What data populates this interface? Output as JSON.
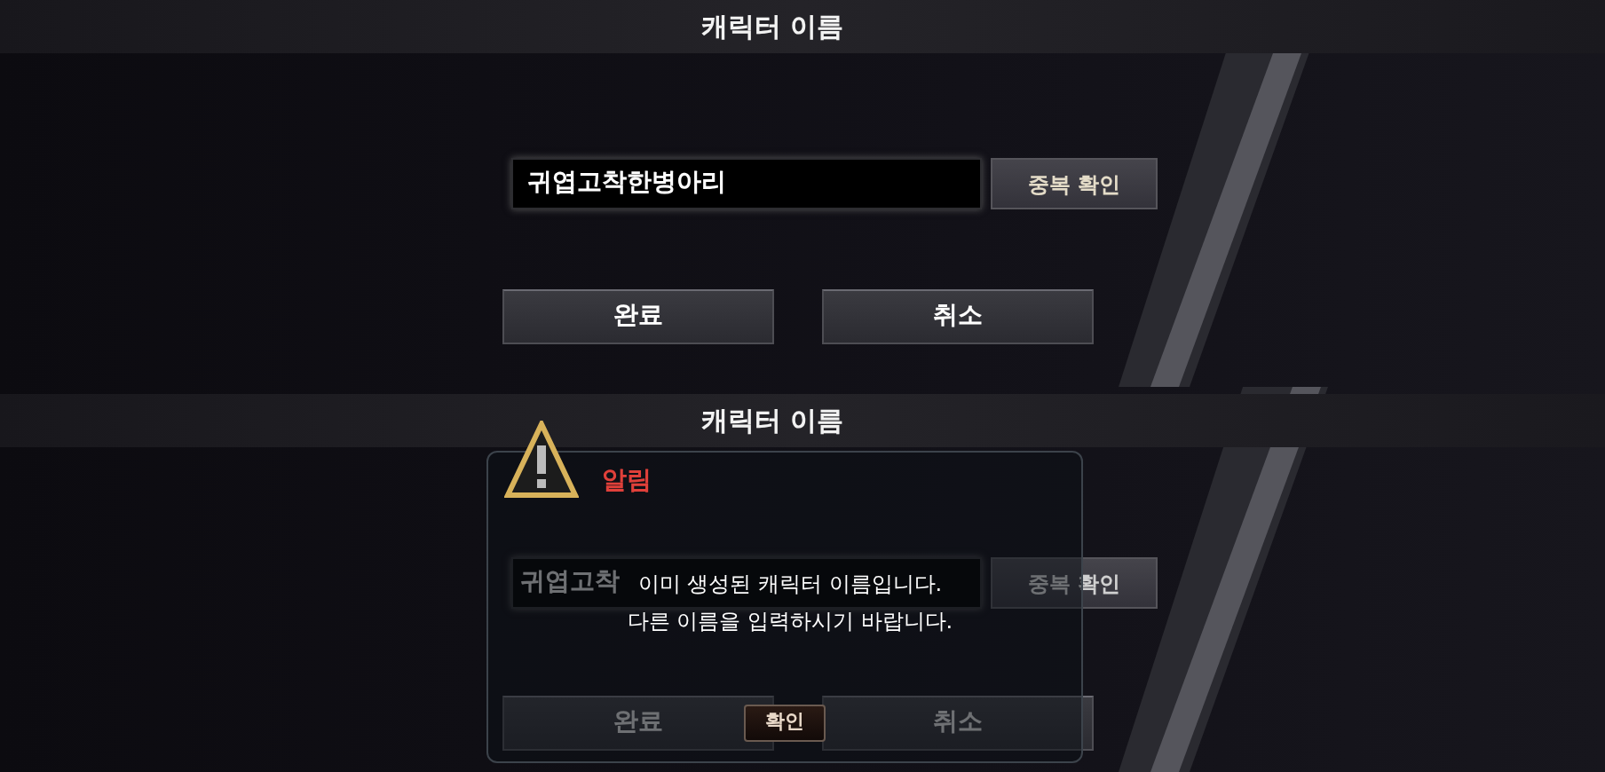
{
  "screens": [
    {
      "title": "캐릭터 이름",
      "name_field": {
        "value": "귀엽고착한병아리"
      },
      "check_button": "중복 확인",
      "buttons": [
        "완료",
        "취소"
      ],
      "dimmed": false
    },
    {
      "title": "캐릭터 이름",
      "name_field": {
        "value": "귀엽고착"
      },
      "check_button": "중복 확인",
      "buttons": [
        "완료",
        "취소"
      ],
      "dimmed": true,
      "dialog": {
        "title": "알림",
        "message": [
          "이미 생성된 캐릭터 이름입니다.",
          "다른 이름을 입력하시기 바랍니다."
        ],
        "button": "확인"
      }
    }
  ]
}
